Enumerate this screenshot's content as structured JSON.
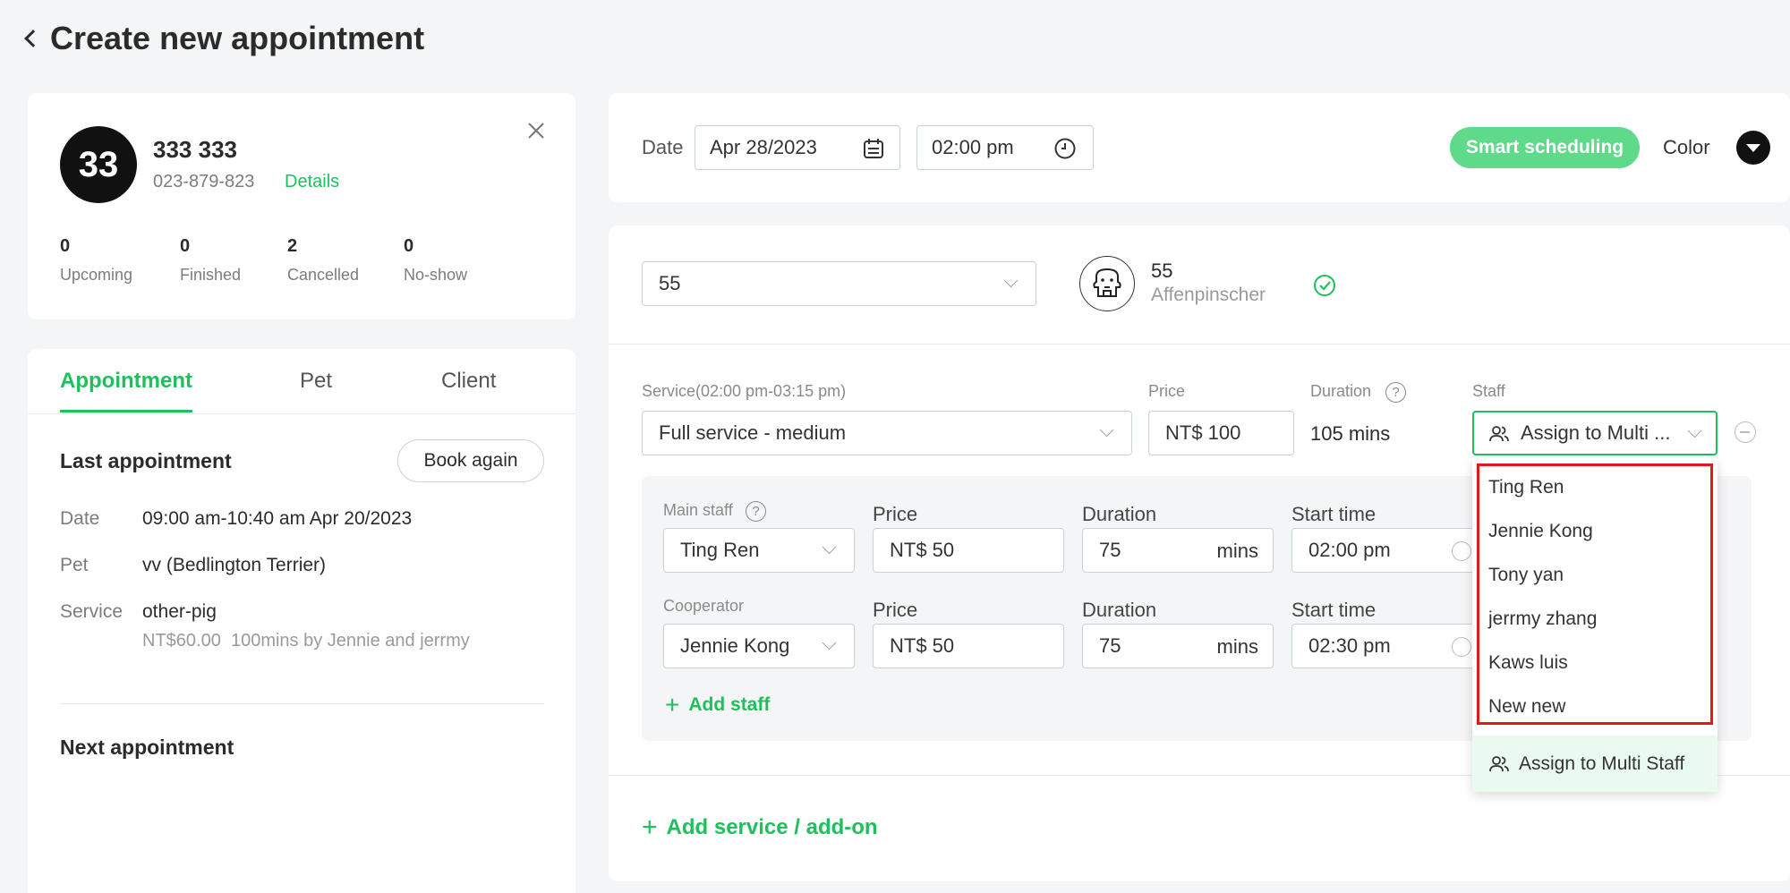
{
  "header": {
    "title": "Create new appointment"
  },
  "client": {
    "avatar": "33",
    "name": "333 333",
    "phone": "023-879-823",
    "details_link": "Details",
    "stats": [
      {
        "value": "0",
        "label": "Upcoming"
      },
      {
        "value": "0",
        "label": "Finished"
      },
      {
        "value": "2",
        "label": "Cancelled"
      },
      {
        "value": "0",
        "label": "No-show"
      }
    ]
  },
  "tabs": [
    "Appointment",
    "Pet",
    "Client"
  ],
  "last_appointment": {
    "title": "Last appointment",
    "book_again": "Book again",
    "date_label": "Date",
    "date_value": "09:00 am-10:40 am Apr 20/2023",
    "pet_label": "Pet",
    "pet_value": "vv (Bedlington Terrier)",
    "service_label": "Service",
    "service_value": "other-pig",
    "service_detail": "NT$60.00  100mins by Jennie and jerrmy"
  },
  "next_appointment": {
    "title": "Next appointment"
  },
  "schedule": {
    "date_label": "Date",
    "date_value": "Apr 28/2023",
    "time_value": "02:00 pm",
    "smart_button": "Smart scheduling",
    "color_label": "Color"
  },
  "pet": {
    "select_value": "55",
    "name": "55",
    "breed": "Affenpinscher"
  },
  "service": {
    "label": "Service(02:00 pm-03:15 pm)",
    "value": "Full service - medium",
    "price_label": "Price",
    "price_value": "NT$ 100",
    "duration_label": "Duration",
    "duration_value": "105 mins",
    "staff_label": "Staff",
    "staff_value": "Assign to Multi ..."
  },
  "staff_rows": [
    {
      "role": "Main staff",
      "name": "Ting Ren",
      "price_label": "Price",
      "price": "NT$ 50",
      "duration_label": "Duration",
      "duration": "75",
      "unit": "mins",
      "start_label": "Start time",
      "start": "02:00 pm"
    },
    {
      "role": "Cooperator",
      "name": "Jennie Kong",
      "price_label": "Price",
      "price": "NT$ 50",
      "duration_label": "Duration",
      "duration": "75",
      "unit": "mins",
      "start_label": "Start time",
      "start": "02:30 pm"
    }
  ],
  "add_staff": "Add staff",
  "add_service": "Add service / add-on",
  "dropdown": {
    "options": [
      "Ting Ren",
      "Jennie Kong",
      "Tony yan",
      "jerrmy zhang",
      "Kaws luis",
      "New new"
    ],
    "footer": "Assign to Multi Staff"
  },
  "colors": {
    "accent": "#1fbf5c",
    "smart_button_bg": "#5fd98a",
    "highlight": "#e0191f"
  }
}
